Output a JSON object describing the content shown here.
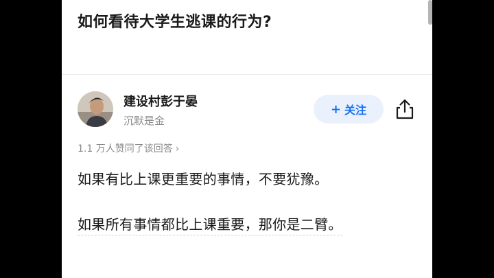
{
  "question": {
    "title": "如何看待大学生逃课的行为?"
  },
  "author": {
    "name": "建设村彭于晏",
    "tagline": "沉默是金",
    "follow_label": "关注",
    "follow_icon": "plus-icon",
    "share_icon": "share-icon"
  },
  "answer": {
    "upvote_summary": "1.1 万人赞同了该回答",
    "lines": [
      "如果有比上课更重要的事情，不要犹豫。",
      "如果所有事情都比上课重要，那你是二臂。"
    ]
  },
  "colors": {
    "accent": "#1772f6",
    "follow_bg": "#eaf1fd",
    "muted_text": "#8a8a8a",
    "text": "#1a1a1a"
  }
}
